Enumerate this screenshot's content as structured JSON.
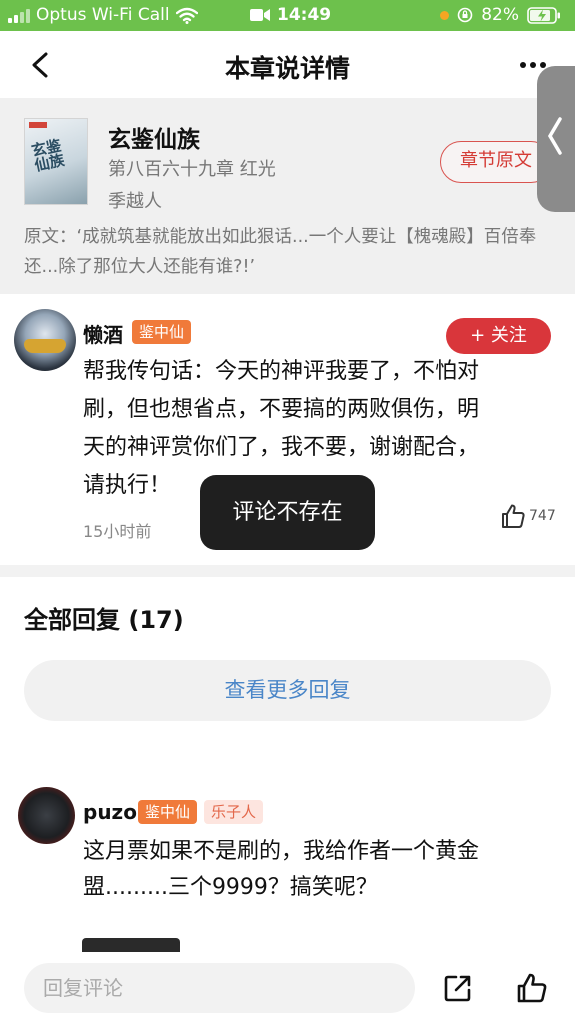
{
  "status_bar": {
    "carrier": "Optus Wi-Fi Call",
    "time": "14:49",
    "battery": "82%",
    "icons": [
      "signal-icon",
      "wifi-icon",
      "video-camera-icon",
      "orange-dot-indicator",
      "rotation-lock-icon",
      "battery-charging-icon"
    ]
  },
  "nav": {
    "title": "本章说详情",
    "back_icon": "chevron-left-icon",
    "more_icon": "more-dots-icon"
  },
  "book": {
    "title": "玄鉴仙族",
    "chapter": "第八百六十九章 红光",
    "author": "季越人",
    "original_button": "章节原文",
    "quote": "原文：‘成就筑基就能放出如此狠话...一个人要让【槐魂殿】百倍奉还...除了那位大人还能有谁?!’",
    "cover_text": "玄鉴仙族"
  },
  "main_comment": {
    "username": "懒酒",
    "badge": "鉴中仙",
    "follow_label": "+ 关注",
    "text": "帮我传句话：今天的神评我要了，不怕对刷，但也想省点，不要搞的两败俱伤，明天的神评赏你们了，我不要，谢谢配合，请执行！",
    "time": "15小时前",
    "likes": "747"
  },
  "toast": "评论不存在",
  "replies": {
    "title": "全部回复 (17)",
    "more_label": "查看更多回复",
    "items": [
      {
        "username": "puzo",
        "badges": [
          "鉴中仙",
          "乐子人"
        ],
        "text": "这月票如果不是刷的，我给作者一个黄金盟.........三个9999？搞笑呢？"
      }
    ]
  },
  "bottom_bar": {
    "input_placeholder": "回复评论",
    "share_icon": "share-icon",
    "like_icon": "thumbs-up-icon"
  },
  "colors": {
    "status_bar_bg": "#6dc14c",
    "accent_red": "#d9363b",
    "badge_orange": "#f07a3a",
    "link_blue": "#4a86c8"
  }
}
